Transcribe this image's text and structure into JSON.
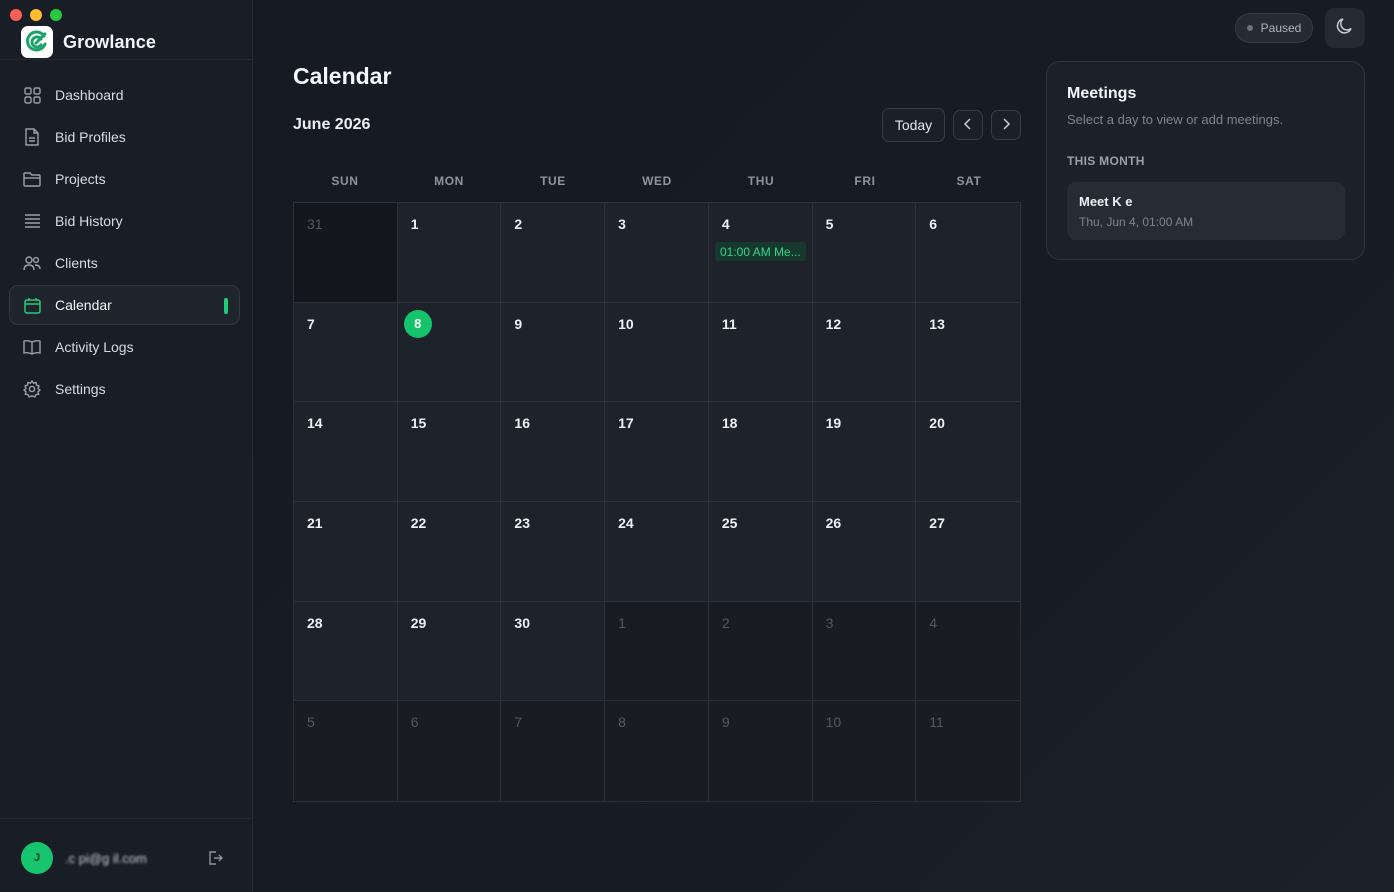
{
  "app": {
    "name": "Growlance"
  },
  "colors": {
    "accent": "#14c46c",
    "event_bg": "#17392d",
    "event_text": "#38d389"
  },
  "sidebar": {
    "items": [
      {
        "label": "Dashboard",
        "icon": "grid-icon",
        "active": false
      },
      {
        "label": "Bid Profiles",
        "icon": "document-icon",
        "active": false
      },
      {
        "label": "Projects",
        "icon": "folder-icon",
        "active": false
      },
      {
        "label": "Bid History",
        "icon": "list-icon",
        "active": false
      },
      {
        "label": "Clients",
        "icon": "users-icon",
        "active": false
      },
      {
        "label": "Calendar",
        "icon": "calendar-icon",
        "active": true
      },
      {
        "label": "Activity Logs",
        "icon": "book-icon",
        "active": false
      },
      {
        "label": "Settings",
        "icon": "gear-icon",
        "active": false
      }
    ],
    "user": {
      "initial": "J",
      "email": ".c pi@g il.com"
    }
  },
  "status": {
    "label": "Paused"
  },
  "calendar": {
    "title": "Calendar",
    "month": "June 2026",
    "today_label": "Today",
    "weekdays": [
      "SUN",
      "MON",
      "TUE",
      "WED",
      "THU",
      "FRI",
      "SAT"
    ],
    "days": [
      {
        "n": "31",
        "type": "dark"
      },
      {
        "n": "1"
      },
      {
        "n": "2"
      },
      {
        "n": "3"
      },
      {
        "n": "4",
        "event": "01:00 AM Me..."
      },
      {
        "n": "5"
      },
      {
        "n": "6"
      },
      {
        "n": "7"
      },
      {
        "n": "8",
        "today": true
      },
      {
        "n": "9"
      },
      {
        "n": "10"
      },
      {
        "n": "11"
      },
      {
        "n": "12"
      },
      {
        "n": "13"
      },
      {
        "n": "14"
      },
      {
        "n": "15"
      },
      {
        "n": "16"
      },
      {
        "n": "17"
      },
      {
        "n": "18"
      },
      {
        "n": "19"
      },
      {
        "n": "20"
      },
      {
        "n": "21"
      },
      {
        "n": "22"
      },
      {
        "n": "23"
      },
      {
        "n": "24"
      },
      {
        "n": "25"
      },
      {
        "n": "26"
      },
      {
        "n": "27"
      },
      {
        "n": "28"
      },
      {
        "n": "29"
      },
      {
        "n": "30"
      },
      {
        "n": "1",
        "type": "other"
      },
      {
        "n": "2",
        "type": "other"
      },
      {
        "n": "3",
        "type": "other"
      },
      {
        "n": "4",
        "type": "other"
      },
      {
        "n": "5",
        "type": "other"
      },
      {
        "n": "6",
        "type": "other"
      },
      {
        "n": "7",
        "type": "other"
      },
      {
        "n": "8",
        "type": "other"
      },
      {
        "n": "9",
        "type": "other"
      },
      {
        "n": "10",
        "type": "other"
      },
      {
        "n": "11",
        "type": "other"
      }
    ]
  },
  "meetings": {
    "title": "Meetings",
    "subtitle": "Select a day to view or add meetings.",
    "section": "THIS MONTH",
    "items": [
      {
        "title": "Meet K  e",
        "date": "Thu, Jun 4, 01:00 AM"
      }
    ]
  }
}
